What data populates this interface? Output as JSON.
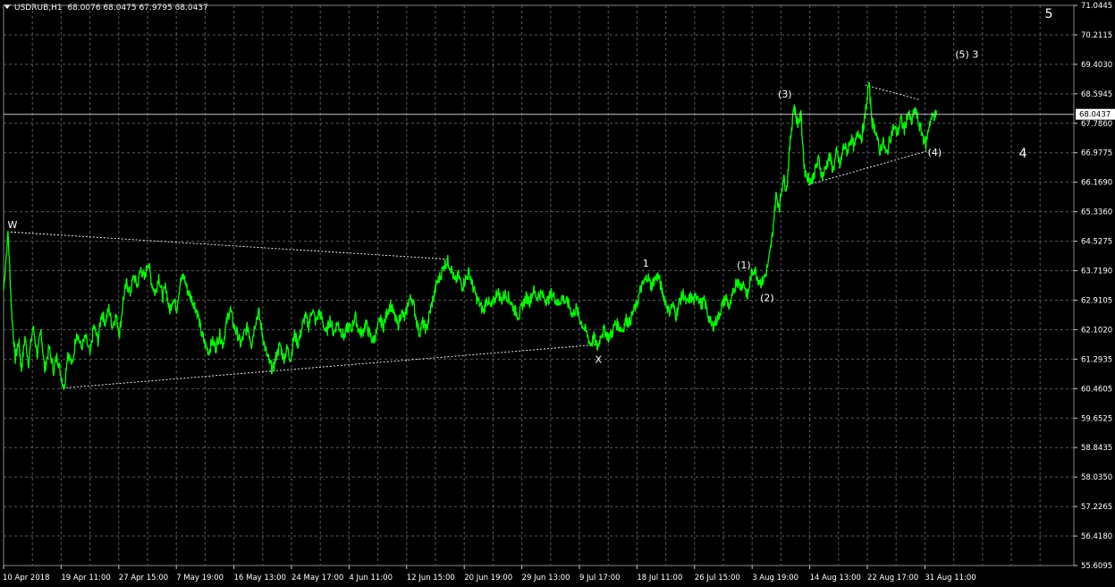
{
  "header": {
    "symbol_tf": "USDRUB,H1",
    "ohlc": "68.0076 68.0475 67.9795 68.0437"
  },
  "colors": {
    "background": "#000000",
    "grid": "#5a5a5a",
    "series": "#00ff00",
    "axis_text": "#ffffff",
    "price_box_bg": "#ffffff",
    "price_box_text": "#000000"
  },
  "chart_data": {
    "type": "line",
    "title": "USDRUB,H1",
    "grid": true,
    "current_price": "68.0437",
    "y_ticks": [
      "71.0445",
      "70.2115",
      "69.4030",
      "68.5945",
      "67.7860",
      "66.9775",
      "66.1690",
      "65.3360",
      "64.5275",
      "63.7190",
      "62.9105",
      "62.1020",
      "61.2935",
      "60.4605",
      "59.6525",
      "58.8435",
      "58.0350",
      "57.2265",
      "56.4180",
      "55.6095"
    ],
    "ylim": [
      55.6095,
      71.0445
    ],
    "x_ticks": [
      "10 Apr 2018",
      "19 Apr 11:00",
      "27 Apr 15:00",
      "7 May 19:00",
      "16 May 13:00",
      "24 May 17:00",
      "4 Jun 11:00",
      "12 Jun 15:00",
      "20 Jun 19:00",
      "29 Jun 13:00",
      "9 Jul 17:00",
      "18 Jul 11:00",
      "26 Jul 15:00",
      "3 Aug 19:00",
      "14 Aug 13:00",
      "22 Aug 17:00",
      "31 Aug 11:00"
    ],
    "x_index_range": [
      0,
      1200
    ],
    "series": [
      {
        "values": [
          [
            0,
            63.2
          ],
          [
            5,
            64.8
          ],
          [
            9,
            62.6
          ],
          [
            13,
            61.3
          ],
          [
            17,
            61.8
          ],
          [
            20,
            61.0
          ],
          [
            24,
            61.9
          ],
          [
            28,
            61.2
          ],
          [
            33,
            62.2
          ],
          [
            38,
            61.4
          ],
          [
            42,
            62.1
          ],
          [
            46,
            61.0
          ],
          [
            51,
            61.6
          ],
          [
            56,
            61.0
          ],
          [
            60,
            61.4
          ],
          [
            64,
            60.9
          ],
          [
            68,
            60.5
          ],
          [
            72,
            61.5
          ],
          [
            77,
            61.1
          ],
          [
            82,
            62.1
          ],
          [
            87,
            61.6
          ],
          [
            92,
            61.9
          ],
          [
            97,
            61.4
          ],
          [
            101,
            62.2
          ],
          [
            106,
            61.8
          ],
          [
            110,
            62.6
          ],
          [
            114,
            62.3
          ],
          [
            118,
            62.7
          ],
          [
            122,
            62.2
          ],
          [
            126,
            62.5
          ],
          [
            130,
            62.0
          ],
          [
            134,
            62.9
          ],
          [
            138,
            63.4
          ],
          [
            142,
            63.1
          ],
          [
            146,
            63.6
          ],
          [
            150,
            63.3
          ],
          [
            154,
            63.8
          ],
          [
            158,
            63.5
          ],
          [
            162,
            64.0
          ],
          [
            166,
            63.4
          ],
          [
            170,
            63.1
          ],
          [
            174,
            63.6
          ],
          [
            178,
            63.0
          ],
          [
            182,
            63.3
          ],
          [
            186,
            62.6
          ],
          [
            190,
            63.0
          ],
          [
            194,
            62.7
          ],
          [
            198,
            63.4
          ],
          [
            202,
            63.6
          ],
          [
            206,
            63.2
          ],
          [
            210,
            63.0
          ],
          [
            214,
            62.8
          ],
          [
            218,
            62.5
          ],
          [
            222,
            62.0
          ],
          [
            226,
            61.7
          ],
          [
            230,
            61.5
          ],
          [
            234,
            61.8
          ],
          [
            238,
            61.6
          ],
          [
            242,
            62.0
          ],
          [
            246,
            61.7
          ],
          [
            250,
            62.3
          ],
          [
            254,
            62.7
          ],
          [
            258,
            62.2
          ],
          [
            262,
            62.0
          ],
          [
            266,
            61.7
          ],
          [
            270,
            62.0
          ],
          [
            274,
            62.2
          ],
          [
            278,
            61.7
          ],
          [
            282,
            62.3
          ],
          [
            286,
            62.6
          ],
          [
            290,
            62.0
          ],
          [
            294,
            61.5
          ],
          [
            298,
            61.2
          ],
          [
            302,
            61.0
          ],
          [
            306,
            61.4
          ],
          [
            310,
            61.7
          ],
          [
            314,
            61.3
          ],
          [
            318,
            61.6
          ],
          [
            322,
            61.3
          ],
          [
            326,
            62.0
          ],
          [
            330,
            61.7
          ],
          [
            334,
            62.1
          ],
          [
            338,
            62.5
          ],
          [
            342,
            62.2
          ],
          [
            346,
            62.7
          ],
          [
            350,
            62.3
          ],
          [
            354,
            62.6
          ],
          [
            358,
            62.3
          ],
          [
            362,
            62.0
          ],
          [
            366,
            62.4
          ],
          [
            370,
            62.0
          ],
          [
            374,
            62.3
          ],
          [
            378,
            62.1
          ],
          [
            382,
            61.9
          ],
          [
            386,
            62.2
          ],
          [
            390,
            62.1
          ],
          [
            394,
            62.5
          ],
          [
            398,
            62.1
          ],
          [
            402,
            62.0
          ],
          [
            406,
            62.3
          ],
          [
            410,
            62.0
          ],
          [
            414,
            61.8
          ],
          [
            418,
            62.0
          ],
          [
            422,
            62.4
          ],
          [
            426,
            62.2
          ],
          [
            430,
            62.6
          ],
          [
            434,
            62.8
          ],
          [
            438,
            62.5
          ],
          [
            442,
            62.2
          ],
          [
            446,
            62.6
          ],
          [
            450,
            62.4
          ],
          [
            454,
            62.9
          ],
          [
            458,
            63.0
          ],
          [
            462,
            62.5
          ],
          [
            466,
            62.0
          ],
          [
            470,
            62.3
          ],
          [
            474,
            62.1
          ],
          [
            478,
            62.6
          ],
          [
            482,
            63.0
          ],
          [
            486,
            63.4
          ],
          [
            490,
            63.6
          ],
          [
            494,
            63.9
          ],
          [
            498,
            64.0
          ],
          [
            502,
            63.8
          ],
          [
            506,
            63.4
          ],
          [
            510,
            63.6
          ],
          [
            514,
            63.3
          ],
          [
            518,
            63.5
          ],
          [
            522,
            63.7
          ],
          [
            526,
            63.3
          ],
          [
            530,
            63.0
          ],
          [
            534,
            62.8
          ],
          [
            538,
            62.6
          ],
          [
            542,
            63.0
          ],
          [
            546,
            62.7
          ],
          [
            550,
            62.9
          ],
          [
            554,
            63.2
          ],
          [
            558,
            62.9
          ],
          [
            562,
            63.1
          ],
          [
            566,
            63.0
          ],
          [
            570,
            62.8
          ],
          [
            574,
            62.6
          ],
          [
            578,
            62.5
          ],
          [
            582,
            62.8
          ],
          [
            586,
            63.0
          ],
          [
            590,
            62.9
          ],
          [
            594,
            63.2
          ],
          [
            598,
            63.0
          ],
          [
            602,
            63.1
          ],
          [
            606,
            63.0
          ],
          [
            610,
            62.9
          ],
          [
            614,
            63.1
          ],
          [
            618,
            63.0
          ],
          [
            622,
            62.8
          ],
          [
            626,
            63.0
          ],
          [
            630,
            62.9
          ],
          [
            634,
            62.8
          ],
          [
            638,
            62.5
          ],
          [
            642,
            62.7
          ],
          [
            646,
            62.4
          ],
          [
            650,
            62.2
          ],
          [
            654,
            62.0
          ],
          [
            658,
            61.7
          ],
          [
            662,
            61.9
          ],
          [
            666,
            61.6
          ],
          [
            670,
            62.0
          ],
          [
            674,
            62.1
          ],
          [
            678,
            61.9
          ],
          [
            682,
            62.0
          ],
          [
            686,
            62.3
          ],
          [
            690,
            62.2
          ],
          [
            694,
            62.1
          ],
          [
            698,
            62.4
          ],
          [
            702,
            62.3
          ],
          [
            706,
            62.6
          ],
          [
            710,
            62.8
          ],
          [
            714,
            63.2
          ],
          [
            718,
            63.4
          ],
          [
            722,
            63.6
          ],
          [
            726,
            63.3
          ],
          [
            730,
            63.5
          ],
          [
            734,
            63.6
          ],
          [
            738,
            63.2
          ],
          [
            742,
            62.9
          ],
          [
            746,
            62.6
          ],
          [
            750,
            62.8
          ],
          [
            754,
            62.5
          ],
          [
            758,
            62.9
          ],
          [
            762,
            63.1
          ],
          [
            766,
            62.8
          ],
          [
            770,
            63.0
          ],
          [
            774,
            62.9
          ],
          [
            778,
            63.1
          ],
          [
            782,
            62.8
          ],
          [
            786,
            62.9
          ],
          [
            790,
            62.5
          ],
          [
            794,
            62.2
          ],
          [
            798,
            62.3
          ],
          [
            802,
            62.5
          ],
          [
            806,
            62.8
          ],
          [
            810,
            63.0
          ],
          [
            814,
            62.7
          ],
          [
            818,
            63.1
          ],
          [
            822,
            63.5
          ],
          [
            826,
            63.3
          ],
          [
            830,
            63.4
          ],
          [
            834,
            63.0
          ],
          [
            838,
            63.6
          ],
          [
            842,
            63.8
          ],
          [
            846,
            63.5
          ],
          [
            850,
            63.4
          ],
          [
            854,
            63.6
          ],
          [
            858,
            64.0
          ],
          [
            862,
            64.7
          ],
          [
            866,
            65.8
          ],
          [
            870,
            65.5
          ],
          [
            874,
            66.3
          ],
          [
            878,
            66.0
          ],
          [
            882,
            67.3
          ],
          [
            886,
            68.3
          ],
          [
            890,
            67.8
          ],
          [
            894,
            68.0
          ],
          [
            898,
            66.5
          ],
          [
            902,
            66.3
          ],
          [
            906,
            66.2
          ],
          [
            910,
            66.5
          ],
          [
            914,
            66.8
          ],
          [
            918,
            66.3
          ],
          [
            922,
            66.6
          ],
          [
            926,
            66.9
          ],
          [
            930,
            66.5
          ],
          [
            934,
            67.0
          ],
          [
            938,
            66.6
          ],
          [
            942,
            67.2
          ],
          [
            946,
            67.0
          ],
          [
            950,
            67.4
          ],
          [
            954,
            67.1
          ],
          [
            958,
            67.6
          ],
          [
            962,
            67.4
          ],
          [
            966,
            68.0
          ],
          [
            970,
            68.9
          ],
          [
            974,
            67.8
          ],
          [
            978,
            67.6
          ],
          [
            982,
            67.0
          ],
          [
            986,
            67.3
          ],
          [
            990,
            66.9
          ],
          [
            994,
            67.4
          ],
          [
            998,
            67.7
          ],
          [
            1002,
            67.5
          ],
          [
            1006,
            67.9
          ],
          [
            1010,
            67.6
          ],
          [
            1014,
            68.1
          ],
          [
            1018,
            67.8
          ],
          [
            1022,
            68.2
          ],
          [
            1026,
            67.8
          ],
          [
            1030,
            67.5
          ],
          [
            1034,
            67.2
          ],
          [
            1038,
            67.8
          ],
          [
            1042,
            68.0
          ],
          [
            1046,
            68.04
          ]
        ]
      }
    ],
    "annotations": [
      {
        "text": "W",
        "x": 10,
        "y": 64.9
      },
      {
        "text": "X",
        "x": 667,
        "y": 61.2
      },
      {
        "text": "1",
        "x": 720,
        "y": 63.85
      },
      {
        "text": "(1)",
        "x": 830,
        "y": 63.8
      },
      {
        "text": "(2)",
        "x": 856,
        "y": 62.9
      },
      {
        "text": "(3)",
        "x": 876,
        "y": 68.5
      },
      {
        "text": "(4)",
        "x": 1044,
        "y": 66.9
      },
      {
        "text": "(5) 3",
        "x": 1080,
        "y": 69.6
      },
      {
        "text": "4",
        "x": 1143,
        "y": 66.85
      },
      {
        "text": "5",
        "x": 1172,
        "y": 70.7
      }
    ],
    "trendlines": [
      [
        [
          8,
          64.8
        ],
        [
          498,
          64.05
        ]
      ],
      [
        [
          66,
          60.5
        ],
        [
          668,
          61.7
        ]
      ],
      [
        [
          966,
          68.85
        ],
        [
          1026,
          68.45
        ]
      ],
      [
        [
          902,
          66.1
        ],
        [
          1038,
          67.05
        ]
      ]
    ]
  }
}
